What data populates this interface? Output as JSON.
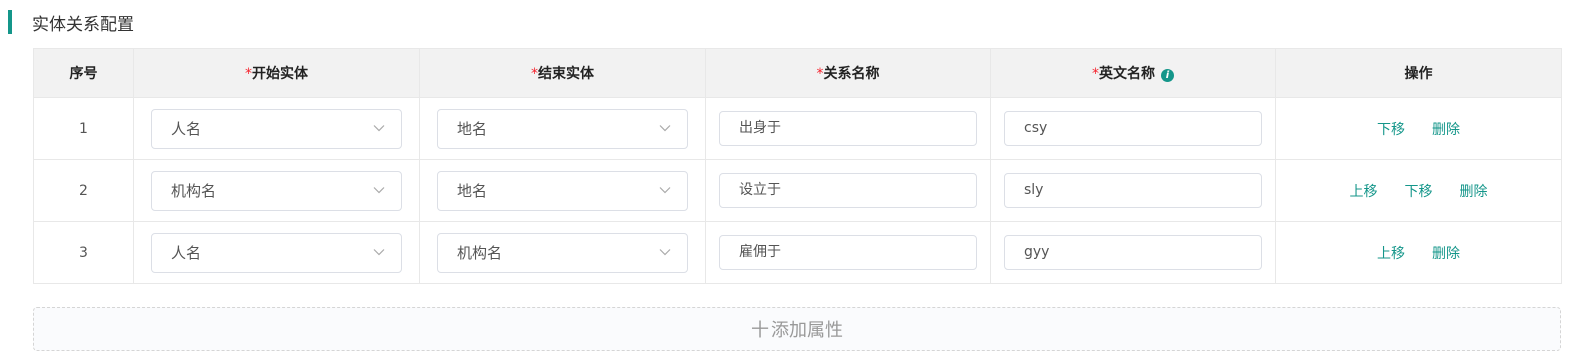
{
  "section": {
    "title": "实体关系配置"
  },
  "table": {
    "headers": {
      "index": "序号",
      "start_entity": "开始实体",
      "end_entity": "结束实体",
      "relation_name": "关系名称",
      "english_name": "英文名称",
      "actions": "操作"
    },
    "required_mark": "*",
    "rows": [
      {
        "index": "1",
        "start_entity": "人名",
        "end_entity": "地名",
        "relation_name": "出身于",
        "english_name": "csy",
        "actions": [
          "下移",
          "删除"
        ]
      },
      {
        "index": "2",
        "start_entity": "机构名",
        "end_entity": "地名",
        "relation_name": "设立于",
        "english_name": "sly",
        "actions": [
          "上移",
          "下移",
          "删除"
        ]
      },
      {
        "index": "3",
        "start_entity": "人名",
        "end_entity": "机构名",
        "relation_name": "雇佣于",
        "english_name": "gyy",
        "actions": [
          "上移",
          "删除"
        ]
      }
    ]
  },
  "add_button": {
    "plus": "十",
    "label": "添加属性"
  },
  "icons": {
    "info": "info-icon",
    "chevron": "chevron-down-icon"
  },
  "colors": {
    "accent": "#14968a",
    "required": "#f5222d",
    "header_bg": "#f2f2f2",
    "border": "#e8e8e8"
  }
}
